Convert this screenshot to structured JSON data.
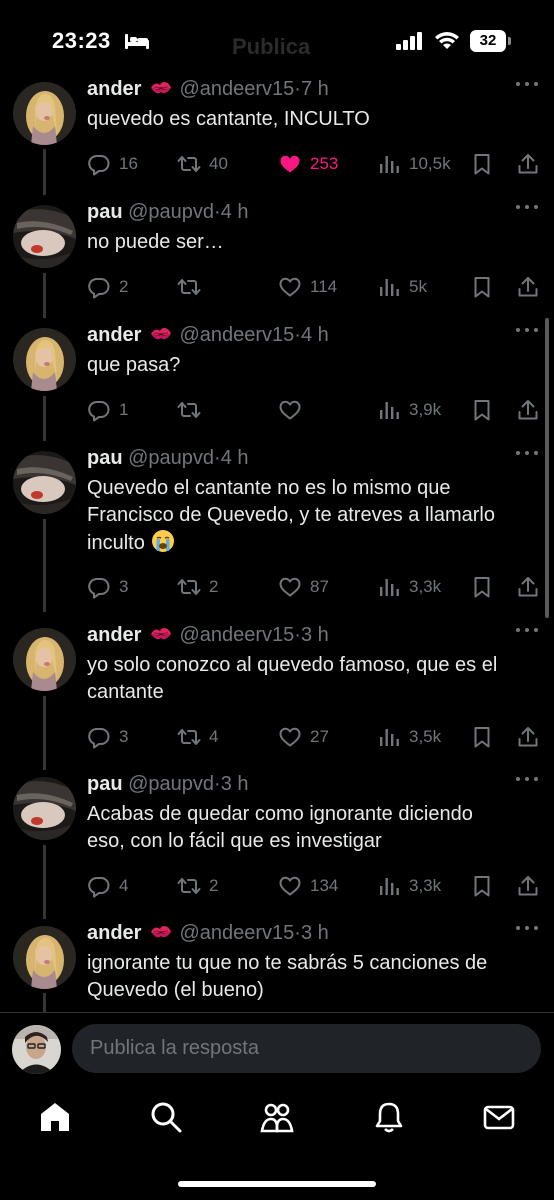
{
  "status_bar": {
    "time": "23:23",
    "battery": "32",
    "faded_title": "Publica"
  },
  "tweets": [
    {
      "name": "ander",
      "handle": "@andeerv15",
      "dot": "·",
      "ago": "7 h",
      "avatar": "blonde-girl",
      "lines": [
        "quevedo es cantante, INCULTO"
      ],
      "replies": "16",
      "retweets": "40",
      "likes": "253",
      "liked": true,
      "views": "10,5k"
    },
    {
      "name": "pau",
      "handle": "@paupvd",
      "dot": "·",
      "ago": "4 h",
      "avatar": "dark-hair-girl",
      "lines": [
        "no puede ser…"
      ],
      "replies": "2",
      "retweets": "",
      "likes": "114",
      "liked": false,
      "views": "5k"
    },
    {
      "name": "ander",
      "handle": "@andeerv15",
      "dot": "·",
      "ago": "4 h",
      "avatar": "blonde-girl",
      "lines": [
        "que pasa?"
      ],
      "replies": "1",
      "retweets": "",
      "likes": "",
      "liked": false,
      "views": "3,9k"
    },
    {
      "name": "pau",
      "handle": "@paupvd",
      "dot": "·",
      "ago": "4 h",
      "avatar": "dark-hair-girl",
      "lines": [
        "Quevedo el cantante no es lo mismo que",
        "Francisco de Quevedo, y te atreves a llamarlo",
        "inculto"
      ],
      "emoji_end": "loudly-crying-face",
      "replies": "3",
      "retweets": "2",
      "likes": "87",
      "liked": false,
      "views": "3,3k"
    },
    {
      "name": "ander",
      "handle": "@andeerv15",
      "dot": "·",
      "ago": "3 h",
      "avatar": "blonde-girl",
      "lines": [
        "yo solo conozco al quevedo famoso, que es el",
        "cantante"
      ],
      "replies": "3",
      "retweets": "4",
      "likes": "27",
      "liked": false,
      "views": "3,5k"
    },
    {
      "name": "pau",
      "handle": "@paupvd",
      "dot": "·",
      "ago": "3 h",
      "avatar": "dark-hair-girl",
      "lines": [
        "Acabas de quedar como ignorante diciendo",
        "eso, con lo fácil que es investigar"
      ],
      "replies": "4",
      "retweets": "2",
      "likes": "134",
      "liked": false,
      "views": "3,3k"
    },
    {
      "name": "ander",
      "handle": "@andeerv15",
      "dot": "·",
      "ago": "3 h",
      "avatar": "blonde-girl",
      "lines": [
        "ignorante tu que no te sabrás 5 canciones de",
        "Quevedo (el bueno)"
      ]
    }
  ],
  "reply": {
    "placeholder": "Publica la resposta"
  },
  "nav": [
    "home-icon",
    "search-icon",
    "communities-icon",
    "notifications-icon",
    "messages-icon"
  ],
  "colors": {
    "background": "#000000",
    "text": "#e7e9ea",
    "muted": "#71767b",
    "like": "#f91880",
    "divider": "#2f3336"
  }
}
